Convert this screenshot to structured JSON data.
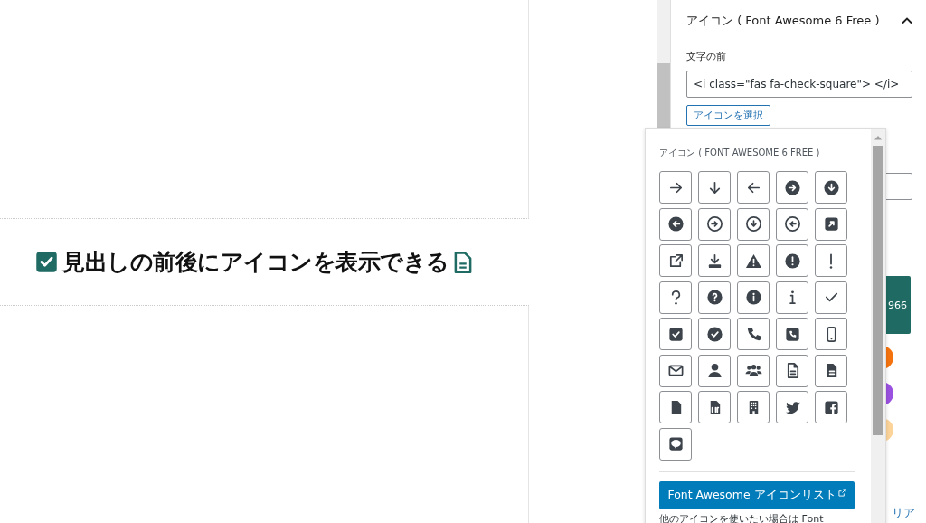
{
  "editor": {
    "heading": "見出しの前後にアイコンを表示できる"
  },
  "sidebar": {
    "panel_title": "アイコン ( Font Awesome 6 Free )",
    "expanded": true,
    "before_label": "文字の前",
    "before_value": "<i class=\"fas fa-check-square\"> </i>",
    "select_button": "アイコンを選択",
    "partial_button": "966",
    "color_swatches": [
      {
        "color": "#f5730f"
      },
      {
        "color": "#9b51e0"
      },
      {
        "color": "#fcd49a"
      }
    ],
    "partial_link": "リア"
  },
  "icon_picker": {
    "title": "アイコン ( FONT AWESOME 6 FREE )",
    "list_button": "Font Awesome アイコンリスト",
    "note": "他のアイコンを使いたい場合は Font"
  }
}
